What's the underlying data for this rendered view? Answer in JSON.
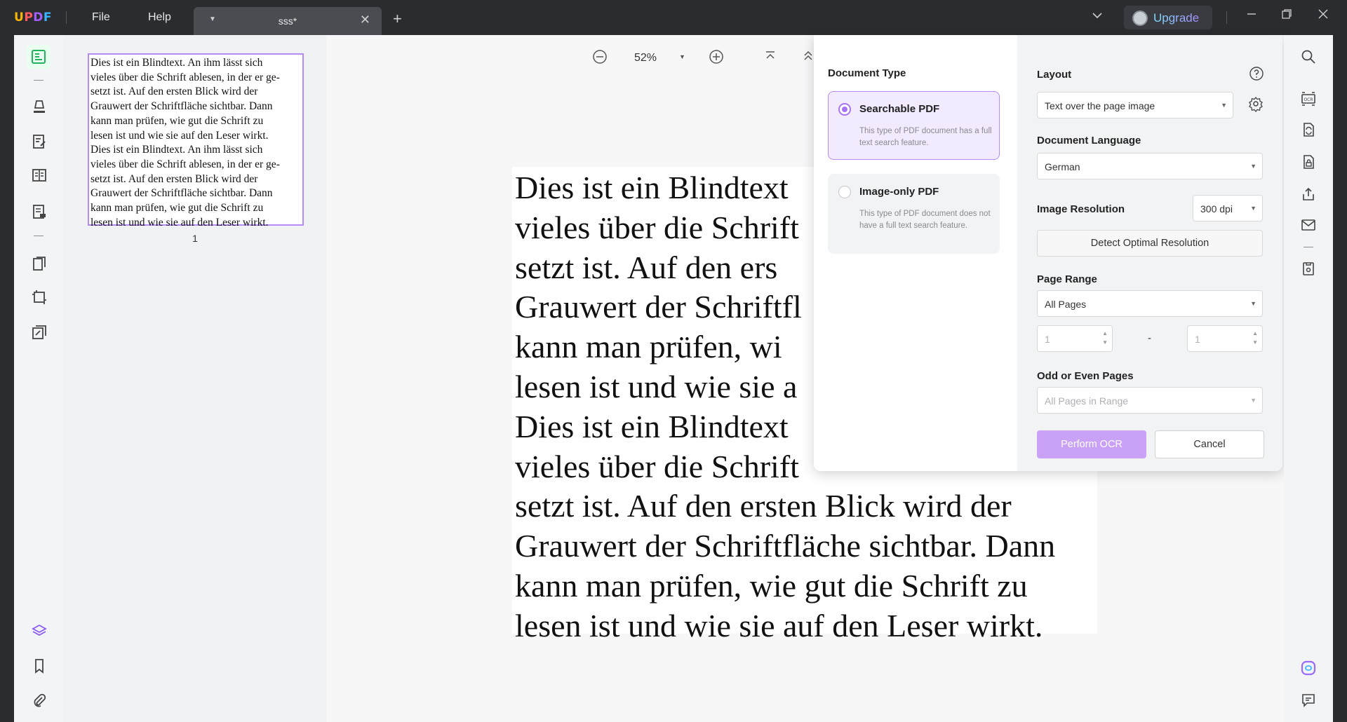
{
  "app": {
    "logo": "UPDF"
  },
  "menu": {
    "file": "File",
    "help": "Help"
  },
  "tab": {
    "name": "sss*"
  },
  "upgrade": {
    "label": "Upgrade"
  },
  "toolbar": {
    "zoom": "52%"
  },
  "thumbnail": {
    "page_number": "1",
    "lines": [
      "Dies ist ein Blindtext. An ihm lässt sich",
      "vieles über die Schrift ablesen, in der er ge-",
      "setzt ist. Auf den ersten Blick wird der",
      "Grauwert der Schriftfläche sichtbar. Dann",
      "kann man prüfen, wie gut die Schrift zu",
      "lesen ist und wie sie auf den Leser wirkt.",
      "Dies ist ein Blindtext. An ihm lässt sich",
      "vieles über die Schrift ablesen, in der er ge-",
      "setzt ist. Auf den ersten Blick wird der",
      "Grauwert der Schriftfläche sichtbar. Dann",
      "kann man prüfen, wie gut die Schrift zu",
      "lesen ist und wie sie auf den Leser wirkt."
    ]
  },
  "page": {
    "lines": [
      "Dies ist ein Blindtext",
      "vieles über die Schrift",
      "setzt ist. Auf den ers",
      "Grauwert der Schriftfl",
      "kann man prüfen, wi",
      "lesen ist und wie sie a",
      "Dies ist ein Blindtext",
      "vieles über die Schrift",
      "setzt ist. Auf den ersten Blick wird der",
      "Grauwert der Schriftfläche sichtbar. Dann",
      "kann man prüfen, wie gut die Schrift zu",
      "lesen ist und wie sie auf den Leser wirkt."
    ]
  },
  "ocr": {
    "document_type_title": "Document Type",
    "options": [
      {
        "title": "Searchable PDF",
        "desc": "This type of PDF document has a full text search feature.",
        "selected": true
      },
      {
        "title": "Image-only PDF",
        "desc": "This type of PDF document does not have a full text search feature.",
        "selected": false
      }
    ],
    "layout_title": "Layout",
    "layout_value": "Text over the page image",
    "language_title": "Document Language",
    "language_value": "German",
    "resolution_title": "Image Resolution",
    "resolution_value": "300 dpi",
    "detect_label": "Detect Optimal Resolution",
    "page_range_title": "Page Range",
    "page_range_value": "All Pages",
    "range_from": "1",
    "range_dash": "-",
    "range_to": "1",
    "odd_even_title": "Odd or Even Pages",
    "odd_even_value": "All Pages in Range",
    "perform_label": "Perform OCR",
    "cancel_label": "Cancel"
  },
  "colors": {
    "accent": "#a873f5",
    "active_icon": "#22b35e"
  }
}
